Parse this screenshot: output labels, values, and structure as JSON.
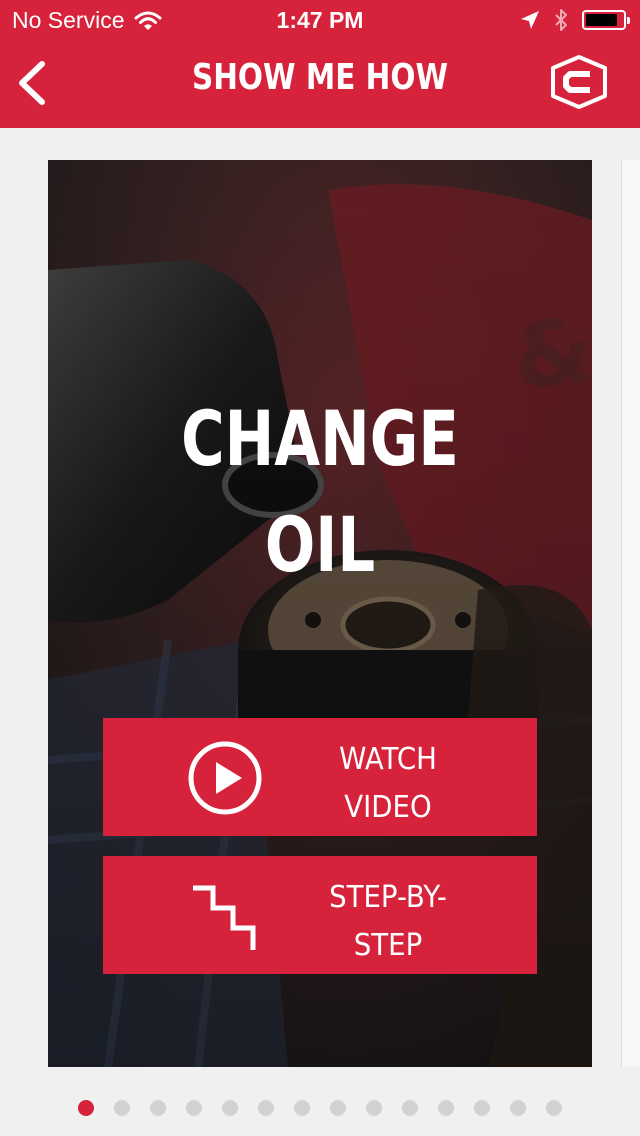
{
  "status_bar": {
    "carrier": "No Service",
    "time": "1:47 PM",
    "battery_level": 0.85
  },
  "nav": {
    "title": "SHOW ME HOW",
    "back_icon": "chevron-left-icon",
    "logo_icon": "brand-shield-logo"
  },
  "card": {
    "title_line1": "CHANGE",
    "title_line2": "OIL",
    "watch_button": {
      "line1": "WATCH",
      "line2": "VIDEO",
      "icon": "play-circle-icon"
    },
    "steps_button": {
      "line1": "STEP-BY-",
      "line2": "STEP",
      "icon": "staircase-icon"
    }
  },
  "pager": {
    "total": 14,
    "current": 1
  },
  "colors": {
    "brand_red": "#d7223b",
    "dot_inactive": "#d2d2d2"
  }
}
